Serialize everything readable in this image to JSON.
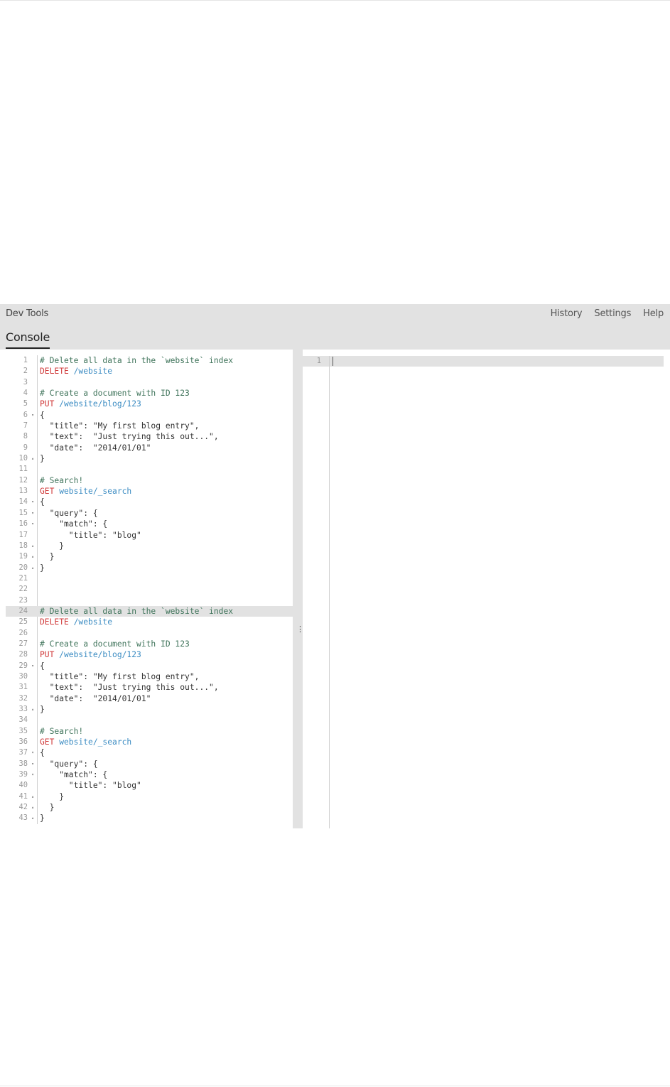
{
  "header": {
    "app_title": "Dev Tools",
    "menu": [
      "History",
      "Settings",
      "Help"
    ],
    "tab": "Console"
  },
  "editor": {
    "lines": [
      {
        "n": "1",
        "fold": "",
        "tokens": [
          {
            "t": "# Delete all data in the `website` index",
            "c": "comment"
          }
        ]
      },
      {
        "n": "2",
        "fold": "",
        "tokens": [
          {
            "t": "DELETE",
            "c": "method"
          },
          {
            "t": " /website",
            "c": "url"
          }
        ]
      },
      {
        "n": "3",
        "fold": "",
        "tokens": []
      },
      {
        "n": "4",
        "fold": "",
        "tokens": [
          {
            "t": "# Create a document with ID 123",
            "c": "comment"
          }
        ]
      },
      {
        "n": "5",
        "fold": "",
        "tokens": [
          {
            "t": "PUT",
            "c": "method"
          },
          {
            "t": " /website/blog/123",
            "c": "url"
          }
        ]
      },
      {
        "n": "6",
        "fold": "▾",
        "tokens": [
          {
            "t": "{",
            "c": ""
          }
        ]
      },
      {
        "n": "7",
        "fold": "",
        "tokens": [
          {
            "t": "  \"title\": \"My first blog entry\",",
            "c": ""
          }
        ]
      },
      {
        "n": "8",
        "fold": "",
        "tokens": [
          {
            "t": "  \"text\":  \"Just trying this out...\",",
            "c": ""
          }
        ]
      },
      {
        "n": "9",
        "fold": "",
        "tokens": [
          {
            "t": "  \"date\":  \"2014/01/01\"",
            "c": ""
          }
        ]
      },
      {
        "n": "10",
        "fold": "▴",
        "tokens": [
          {
            "t": "}",
            "c": ""
          }
        ]
      },
      {
        "n": "11",
        "fold": "",
        "tokens": []
      },
      {
        "n": "12",
        "fold": "",
        "tokens": [
          {
            "t": "# Search!",
            "c": "comment"
          }
        ]
      },
      {
        "n": "13",
        "fold": "",
        "tokens": [
          {
            "t": "GET",
            "c": "method"
          },
          {
            "t": " website/_search",
            "c": "url"
          }
        ]
      },
      {
        "n": "14",
        "fold": "▾",
        "tokens": [
          {
            "t": "{",
            "c": ""
          }
        ]
      },
      {
        "n": "15",
        "fold": "▾",
        "tokens": [
          {
            "t": "  \"query\": {",
            "c": ""
          }
        ]
      },
      {
        "n": "16",
        "fold": "▾",
        "tokens": [
          {
            "t": "    \"match\": {",
            "c": ""
          }
        ]
      },
      {
        "n": "17",
        "fold": "",
        "tokens": [
          {
            "t": "      \"title\": \"blog\"",
            "c": ""
          }
        ]
      },
      {
        "n": "18",
        "fold": "▴",
        "tokens": [
          {
            "t": "    }",
            "c": ""
          }
        ]
      },
      {
        "n": "19",
        "fold": "▴",
        "tokens": [
          {
            "t": "  }",
            "c": ""
          }
        ]
      },
      {
        "n": "20",
        "fold": "▴",
        "tokens": [
          {
            "t": "}",
            "c": ""
          }
        ]
      },
      {
        "n": "21",
        "fold": "",
        "tokens": []
      },
      {
        "n": "22",
        "fold": "",
        "tokens": []
      },
      {
        "n": "23",
        "fold": "",
        "tokens": []
      },
      {
        "n": "24",
        "fold": "",
        "active": true,
        "tokens": [
          {
            "t": "# Delete all data in the `website` index",
            "c": "comment"
          }
        ]
      },
      {
        "n": "25",
        "fold": "",
        "tokens": [
          {
            "t": "DELETE",
            "c": "method"
          },
          {
            "t": " /website",
            "c": "url"
          }
        ]
      },
      {
        "n": "26",
        "fold": "",
        "tokens": []
      },
      {
        "n": "27",
        "fold": "",
        "tokens": [
          {
            "t": "# Create a document with ID 123",
            "c": "comment"
          }
        ]
      },
      {
        "n": "28",
        "fold": "",
        "tokens": [
          {
            "t": "PUT",
            "c": "method"
          },
          {
            "t": " /website/blog/123",
            "c": "url"
          }
        ]
      },
      {
        "n": "29",
        "fold": "▾",
        "tokens": [
          {
            "t": "{",
            "c": ""
          }
        ]
      },
      {
        "n": "30",
        "fold": "",
        "tokens": [
          {
            "t": "  \"title\": \"My first blog entry\",",
            "c": ""
          }
        ]
      },
      {
        "n": "31",
        "fold": "",
        "tokens": [
          {
            "t": "  \"text\":  \"Just trying this out...\",",
            "c": ""
          }
        ]
      },
      {
        "n": "32",
        "fold": "",
        "tokens": [
          {
            "t": "  \"date\":  \"2014/01/01\"",
            "c": ""
          }
        ]
      },
      {
        "n": "33",
        "fold": "▴",
        "tokens": [
          {
            "t": "}",
            "c": ""
          }
        ]
      },
      {
        "n": "34",
        "fold": "",
        "tokens": []
      },
      {
        "n": "35",
        "fold": "",
        "tokens": [
          {
            "t": "# Search!",
            "c": "comment"
          }
        ]
      },
      {
        "n": "36",
        "fold": "",
        "tokens": [
          {
            "t": "GET",
            "c": "method"
          },
          {
            "t": " website/_search",
            "c": "url"
          }
        ]
      },
      {
        "n": "37",
        "fold": "▾",
        "tokens": [
          {
            "t": "{",
            "c": ""
          }
        ]
      },
      {
        "n": "38",
        "fold": "▾",
        "tokens": [
          {
            "t": "  \"query\": {",
            "c": ""
          }
        ]
      },
      {
        "n": "39",
        "fold": "▾",
        "tokens": [
          {
            "t": "    \"match\": {",
            "c": ""
          }
        ]
      },
      {
        "n": "40",
        "fold": "",
        "tokens": [
          {
            "t": "      \"title\": \"blog\"",
            "c": ""
          }
        ]
      },
      {
        "n": "41",
        "fold": "▴",
        "tokens": [
          {
            "t": "    }",
            "c": ""
          }
        ]
      },
      {
        "n": "42",
        "fold": "▴",
        "tokens": [
          {
            "t": "  }",
            "c": ""
          }
        ]
      },
      {
        "n": "43",
        "fold": "▴",
        "tokens": [
          {
            "t": "}",
            "c": ""
          }
        ]
      }
    ]
  },
  "response": {
    "line_number": "1"
  },
  "resizer": {
    "glyph": "⋮"
  },
  "colors": {
    "comment": "#41755c",
    "method": "#d03a3a",
    "url": "#3a8bc2",
    "header_bg": "#e2e2e2"
  }
}
